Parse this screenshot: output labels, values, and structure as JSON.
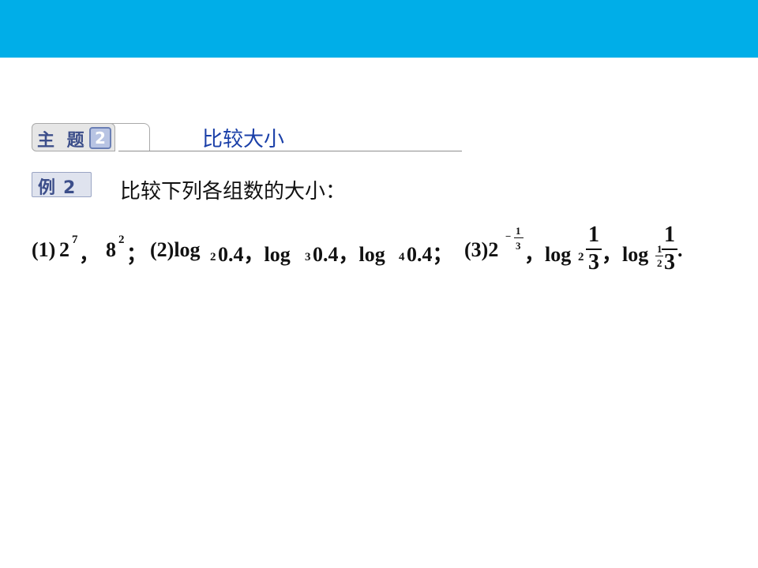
{
  "colors": {
    "top_band": "#00aee8",
    "topic_title": "#1a3fa8",
    "badge_text": "#3c4e8a"
  },
  "topic": {
    "label": "主 题",
    "number": "2",
    "title": "比较大小"
  },
  "example": {
    "label": "例",
    "number": "2",
    "prompt": "比较下列各组数的大小："
  },
  "problem": {
    "p1_label": "(1)",
    "p1_base": "2",
    "p1_exp": "7",
    "p1_sep": "，",
    "p1_b2": "8",
    "p1_b2_exp": "2",
    "p1_end": "；",
    "p2_label": "(2)log",
    "p2_s1": "2",
    "p2_v1": "0.4，log",
    "p2_s2": "3",
    "p2_v2": "0.4，log",
    "p2_s3": "4",
    "p2_v3": "0.4；",
    "p3_label": "(3)2",
    "p3_exp_minus": "−",
    "p3_exp_num": "1",
    "p3_exp_den": "3",
    "p3_sep1": "，log",
    "p3_base1": "2",
    "p3_f1_num": "1",
    "p3_f1_den": "3",
    "p3_sep2": "，log",
    "p3_base2_num": "1",
    "p3_base2_den": "2",
    "p3_f2_num": "1",
    "p3_f2_den": "3",
    "p3_end": "."
  }
}
